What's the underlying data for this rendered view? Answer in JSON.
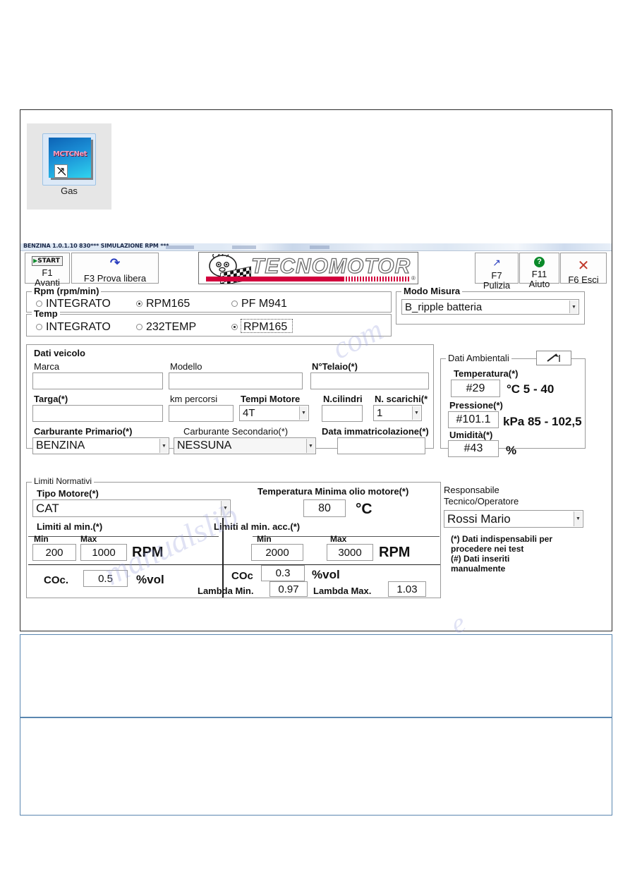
{
  "desktop": {
    "icon_word": "MCTCNet",
    "icon_label": "Gas",
    "icon_name": "shortcut-icon"
  },
  "window": {
    "titlebar": "BENZINA 1.0.1.10  830*** SIMULAZIONE RPM ***"
  },
  "toolbar": {
    "start_badge": "START",
    "f1_key": "F1",
    "f1_label": "Avanti",
    "f3_label": "F3 Prova libera",
    "f7_key": "F7",
    "f7_label": "Pulizia",
    "f11_key": "F11",
    "f11_label": "Aiuto",
    "f6_label": "F6 Esci",
    "logo_text": "TECNOMOTOR",
    "logo_reg": "®"
  },
  "rpm_group": {
    "title": "Rpm (rpm/min)",
    "options": [
      {
        "label": "INTEGRATO",
        "selected": false
      },
      {
        "label": "RPM165",
        "selected": true
      },
      {
        "label": "PF M941",
        "selected": false
      }
    ]
  },
  "temp_group": {
    "title": "Temp",
    "options": [
      {
        "label": "INTEGRATO",
        "selected": false
      },
      {
        "label": "232TEMP",
        "selected": false
      },
      {
        "label": "RPM165",
        "selected": true
      }
    ]
  },
  "modo_misura": {
    "title": "Modo Misura",
    "value": "B_ripple batteria"
  },
  "dati_veicolo": {
    "title": "Dati veicolo",
    "marca_label": "Marca",
    "marca_value": "",
    "modello_label": "Modello",
    "modello_value": "",
    "telaio_label": "N°Telaio(*)",
    "telaio_value": "",
    "targa_label": "Targa(*)",
    "targa_value": "",
    "km_label": "km percorsi",
    "km_value": "",
    "tempi_label": "Tempi Motore",
    "tempi_value": "4T",
    "cilindri_label": "N.cilindri",
    "cilindri_value": "",
    "scarichi_label": "N. scarichi(*",
    "scarichi_value": "1",
    "carb_primario_label": "Carburante Primario(*)",
    "carb_primario_value": "BENZINA",
    "carb_secondario_label": "Carburante Secondario(*)",
    "carb_secondario_value": "NESSUNA",
    "data_imm_label": "Data immatricolazione(*)",
    "data_imm_value": ""
  },
  "dati_ambientali": {
    "title": "Dati Ambientali",
    "edit_icon": "pencil-icon",
    "temperatura_label": "Temperatura(*)",
    "temperatura_value": "#29",
    "temperatura_unit": "°C  5 - 40",
    "pressione_label": "Pressione(*)",
    "pressione_value": "#101.1",
    "pressione_unit": "kPa 85 - 102,5",
    "umidita_label": "Umidità(*)",
    "umidita_value": "#43",
    "umidita_unit": "%"
  },
  "limiti_normativi": {
    "title": "Limiti Normativi",
    "tipo_motore_label": "Tipo Motore(*)",
    "tipo_motore_value": "CAT",
    "temp_olio_label": "Temperatura Minima olio motore(*)",
    "temp_olio_value": "80",
    "temp_olio_unit": "°C",
    "limiti_min_label": "Limiti al min.(*)",
    "limiti_min_acc_label": "Limiti al min. acc.(*)",
    "min_header": "Min",
    "max_header": "Max",
    "min_rpm_min": "200",
    "min_rpm_max": "1000",
    "min_rpm_unit": "RPM",
    "acc_rpm_min": "2000",
    "acc_rpm_max": "3000",
    "acc_rpm_unit": "RPM",
    "coc_label": "COc.",
    "coc_value": "0.5",
    "coc_unit": "%vol",
    "coc2_label": "COc",
    "coc2_value": "0.3",
    "coc2_unit": "%vol",
    "lambda_min_label": "Lambda Min.",
    "lambda_min_value": "0.97",
    "lambda_max_label": "Lambda Max.",
    "lambda_max_value": "1.03"
  },
  "responsabile": {
    "label_line1": "Responsabile",
    "label_line2": "Tecnico/Operatore",
    "value": "Rossi Mario",
    "note_line1": "(*) Dati indispensabili per",
    "note_line2": "procedere nei test",
    "note_line3": "(#) Dati inseriti",
    "note_line4": "manualmente"
  },
  "watermark": {
    "w1": "manualslib",
    "w2": "com",
    "w3": "e"
  }
}
